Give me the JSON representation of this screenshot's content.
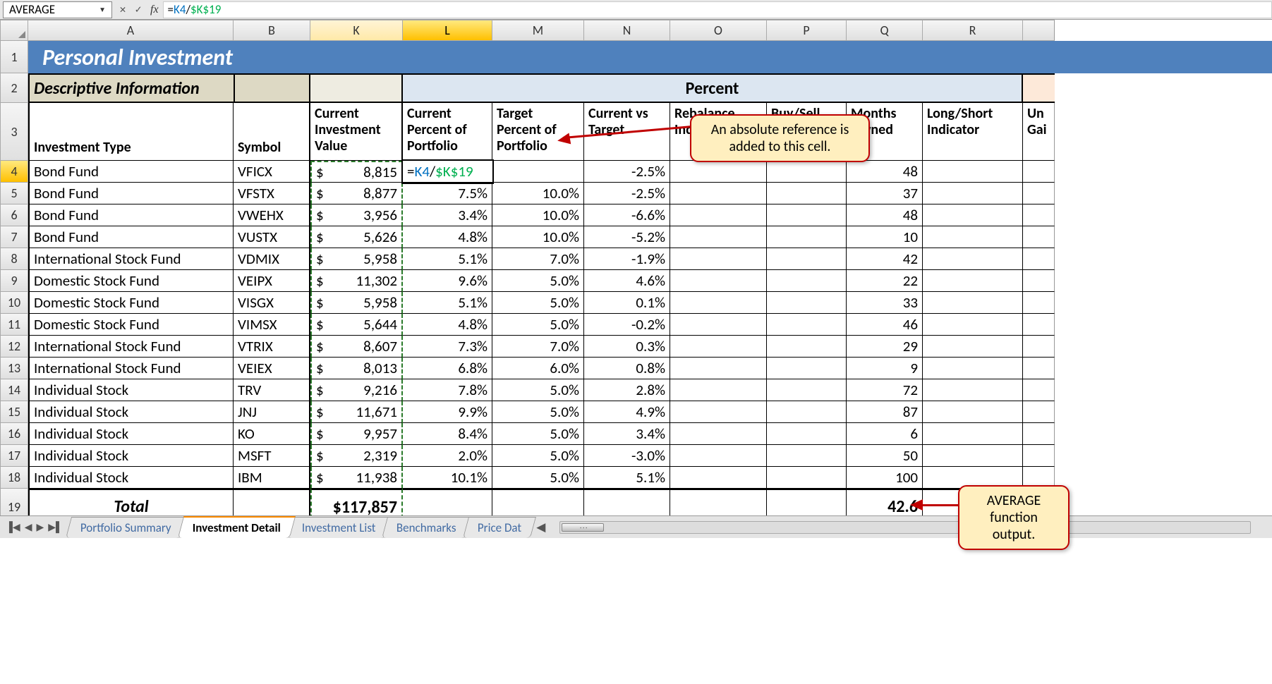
{
  "formula_bar": {
    "name_box": "AVERAGE",
    "cancel": "✕",
    "enter": "✓",
    "fx": "fx",
    "formula_eq": "=",
    "formula_ref1": "K4",
    "formula_slash": "/",
    "formula_ref2": "$K$19"
  },
  "col_letters": [
    "A",
    "B",
    "K",
    "L",
    "M",
    "N",
    "O",
    "P",
    "Q",
    "R"
  ],
  "title": "Personal Investment",
  "section_a": "Descriptive Information",
  "section_pct": "Percent",
  "row3": {
    "A": "Investment Type",
    "B": "Symbol",
    "K": "Current Investment Value",
    "L": "Current Percent of Portfolio",
    "M": "Target Percent of Portfolio",
    "N": "Current vs Target",
    "O": "Rebalance Indicator",
    "P": "Buy/Sell Indicator",
    "Q": "Months Owned",
    "R": "Long/Short Indicator",
    "S": "Un\nGai"
  },
  "rows": [
    {
      "n": 4,
      "A": "Bond Fund",
      "B": "VFICX",
      "K": "8,815",
      "L_formula": "=K4/$K$19",
      "M": "",
      "N": "-2.5%",
      "Q": "48"
    },
    {
      "n": 5,
      "A": "Bond Fund",
      "B": "VFSTX",
      "K": "8,877",
      "L": "7.5%",
      "M": "10.0%",
      "N": "-2.5%",
      "Q": "37"
    },
    {
      "n": 6,
      "A": "Bond Fund",
      "B": "VWEHX",
      "K": "3,956",
      "L": "3.4%",
      "M": "10.0%",
      "N": "-6.6%",
      "Q": "48"
    },
    {
      "n": 7,
      "A": "Bond Fund",
      "B": "VUSTX",
      "K": "5,626",
      "L": "4.8%",
      "M": "10.0%",
      "N": "-5.2%",
      "Q": "10"
    },
    {
      "n": 8,
      "A": "International Stock Fund",
      "B": "VDMIX",
      "K": "5,958",
      "L": "5.1%",
      "M": "7.0%",
      "N": "-1.9%",
      "Q": "42"
    },
    {
      "n": 9,
      "A": "Domestic Stock Fund",
      "B": "VEIPX",
      "K": "11,302",
      "L": "9.6%",
      "M": "5.0%",
      "N": "4.6%",
      "Q": "22"
    },
    {
      "n": 10,
      "A": "Domestic Stock Fund",
      "B": "VISGX",
      "K": "5,958",
      "L": "5.1%",
      "M": "5.0%",
      "N": "0.1%",
      "Q": "33"
    },
    {
      "n": 11,
      "A": "Domestic Stock Fund",
      "B": "VIMSX",
      "K": "5,644",
      "L": "4.8%",
      "M": "5.0%",
      "N": "-0.2%",
      "Q": "46"
    },
    {
      "n": 12,
      "A": "International Stock Fund",
      "B": "VTRIX",
      "K": "8,607",
      "L": "7.3%",
      "M": "7.0%",
      "N": "0.3%",
      "Q": "29"
    },
    {
      "n": 13,
      "A": "International Stock Fund",
      "B": "VEIEX",
      "K": "8,013",
      "L": "6.8%",
      "M": "6.0%",
      "N": "0.8%",
      "Q": "9"
    },
    {
      "n": 14,
      "A": "Individual Stock",
      "B": "TRV",
      "K": "9,216",
      "L": "7.8%",
      "M": "5.0%",
      "N": "2.8%",
      "Q": "72"
    },
    {
      "n": 15,
      "A": "Individual Stock",
      "B": "JNJ",
      "K": "11,671",
      "L": "9.9%",
      "M": "5.0%",
      "N": "4.9%",
      "Q": "87"
    },
    {
      "n": 16,
      "A": "Individual Stock",
      "B": "KO",
      "K": "9,957",
      "L": "8.4%",
      "M": "5.0%",
      "N": "3.4%",
      "Q": "6"
    },
    {
      "n": 17,
      "A": "Individual Stock",
      "B": "MSFT",
      "K": "2,319",
      "L": "2.0%",
      "M": "5.0%",
      "N": "-3.0%",
      "Q": "50"
    },
    {
      "n": 18,
      "A": "Individual Stock",
      "B": "IBM",
      "K": "11,938",
      "L": "10.1%",
      "M": "5.0%",
      "N": "5.1%",
      "Q": "100"
    }
  ],
  "total": {
    "label": "Total",
    "K": "$117,857",
    "Q": "42.6"
  },
  "callout1": "An absolute reference is added to this cell.",
  "callout2_a": "AVERAGE",
  "callout2_b": "function output.",
  "sheet_tabs": [
    "Portfolio Summary",
    "Investment Detail",
    "Investment List",
    "Benchmarks",
    "Price Dat"
  ],
  "active_tab": 1,
  "chart_data": {
    "type": "table",
    "note": "spreadsheet data is in rows[]"
  }
}
